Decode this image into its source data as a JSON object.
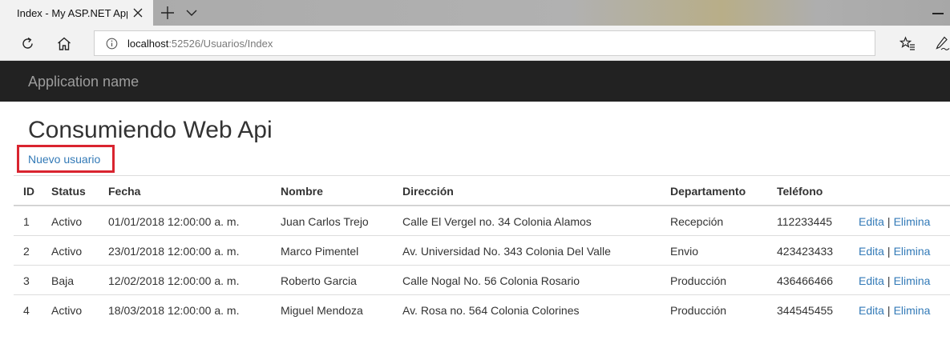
{
  "browser": {
    "tab_title": "Index - My ASP.NET App",
    "url_host": "localhost",
    "url_rest": ":52526/Usuarios/Index"
  },
  "header": {
    "app_name": "Application name"
  },
  "page": {
    "title": "Consumiendo Web Api",
    "new_user_link": "Nuevo usuario"
  },
  "table": {
    "columns": [
      "ID",
      "Status",
      "Fecha",
      "Nombre",
      "Dirección",
      "Departamento",
      "Teléfono"
    ],
    "rows": [
      [
        "1",
        "Activo",
        "01/01/2018 12:00:00 a. m.",
        "Juan Carlos Trejo",
        "Calle El Vergel no. 34 Colonia Alamos",
        "Recepción",
        "112233445"
      ],
      [
        "2",
        "Activo",
        "23/01/2018 12:00:00 a. m.",
        "Marco Pimentel",
        "Av. Universidad No. 343 Colonia Del Valle",
        "Envio",
        "423423433"
      ],
      [
        "3",
        "Baja",
        "12/02/2018 12:00:00 a. m.",
        "Roberto Garcia",
        "Calle Nogal No. 56 Colonia Rosario",
        "Producción",
        "436466466"
      ],
      [
        "4",
        "Activo",
        "18/03/2018 12:00:00 a. m.",
        "Miguel Mendoza",
        "Av. Rosa no. 564 Colonia Colorines",
        "Producción",
        "344545455"
      ]
    ],
    "edit_label": "Edita",
    "delete_label": "Elimina",
    "action_separator": "|"
  },
  "colors": {
    "link": "#337ab7",
    "header_bg": "#222222",
    "app_name": "#9d9d9d",
    "highlight": "#d9242f"
  },
  "icons": {
    "tab_close": "close-icon",
    "new_tab": "plus-icon",
    "tab_list": "chevron-down-icon",
    "refresh": "refresh-icon",
    "home": "home-icon",
    "info": "info-icon",
    "favorites": "favorites-icon",
    "notes": "pen-icon"
  }
}
